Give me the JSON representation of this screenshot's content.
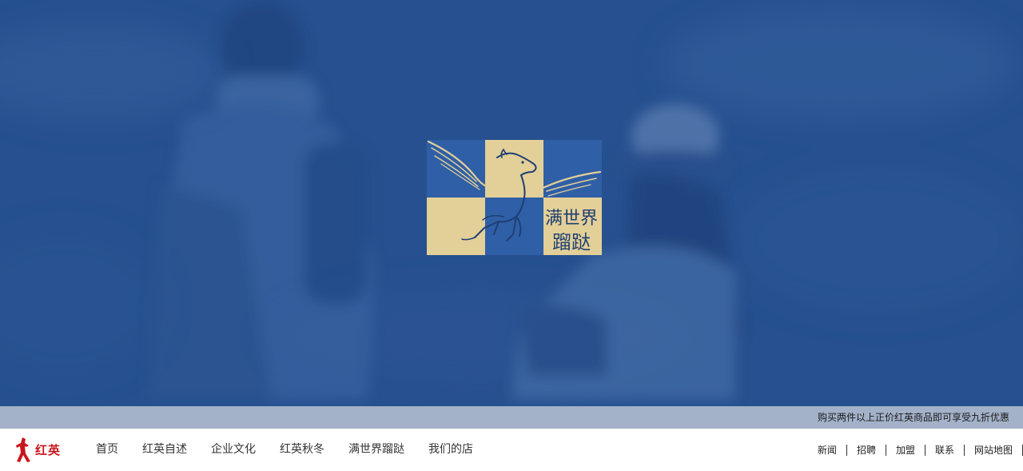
{
  "hero": {
    "logo": {
      "text_line1": "满世界",
      "text_line2": "蹓跶",
      "colors": {
        "blue": "#2f5fa6",
        "beige": "#e3cf98",
        "ink": "#1e3f73"
      }
    },
    "overlay_color": "#26508f"
  },
  "promo": {
    "text": "购买两件以上正价红英商品即可享受九折优惠"
  },
  "nav": {
    "brand": {
      "text": "红英",
      "color": "#c8161d"
    },
    "main_items": [
      "首页",
      "红英自述",
      "企业文化",
      "红英秋冬",
      "满世界蹓跶",
      "我们的店"
    ],
    "util_items": [
      "新闻",
      "招聘",
      "加盟",
      "联系",
      "网站地图"
    ]
  }
}
